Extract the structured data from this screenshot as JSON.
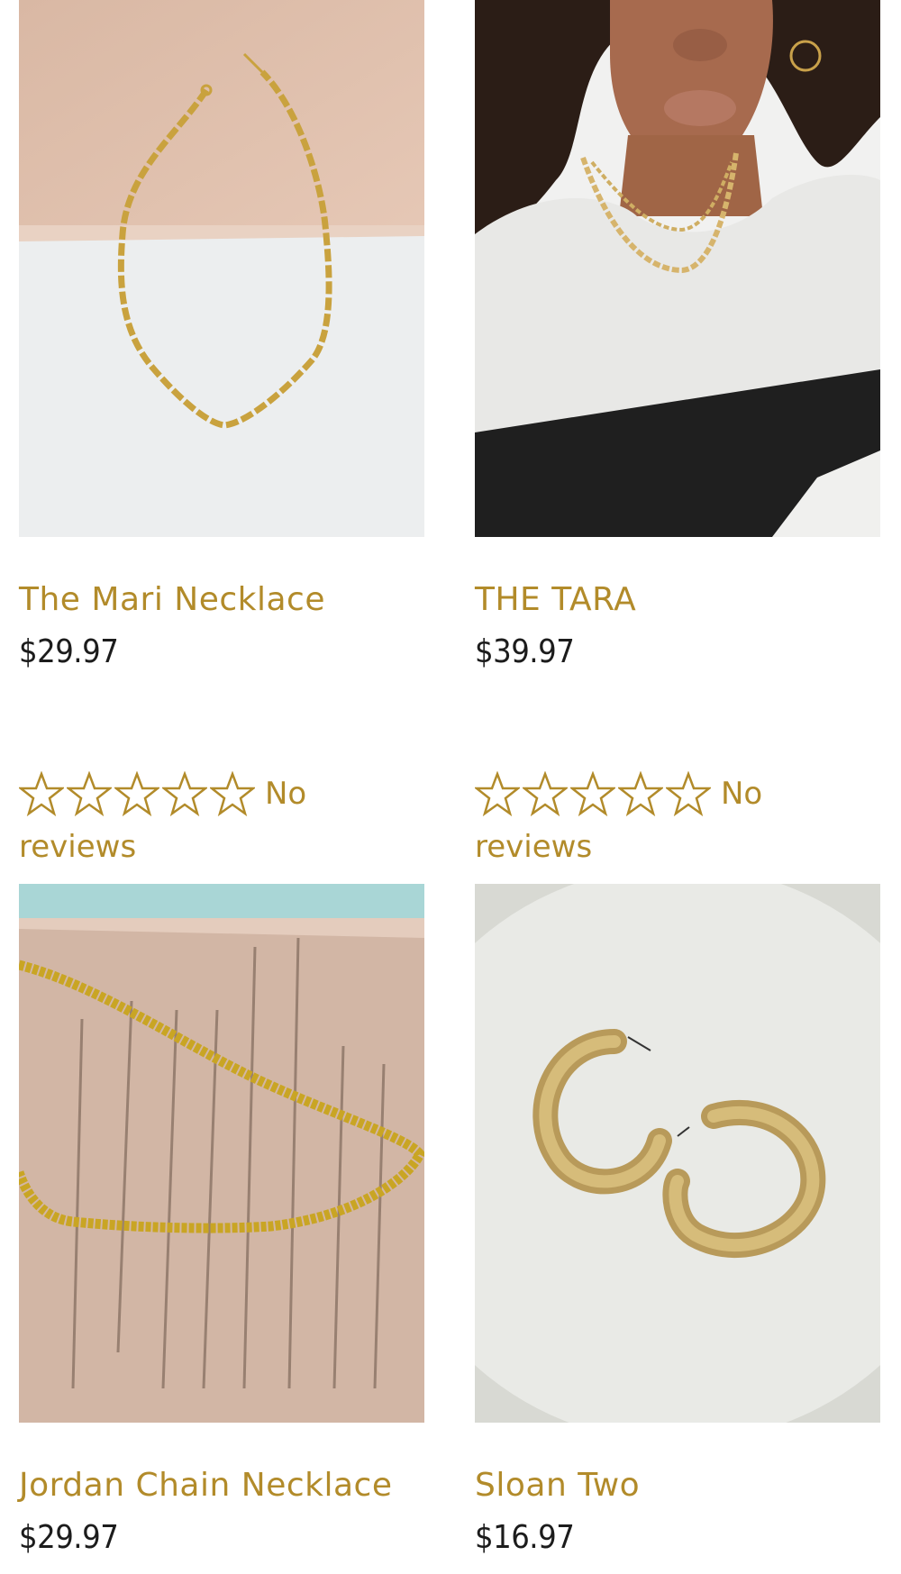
{
  "products": [
    {
      "title": "The Mari Necklace",
      "price": "$29.97",
      "image_label": "gold paperclip chain necklace"
    },
    {
      "title": "THE TARA",
      "price": "$39.97",
      "image_label": "model wearing layered gold chain necklaces"
    },
    {
      "title": "Jordan Chain Necklace",
      "price": "$29.97",
      "image_label": "gold curb chain necklace on book page"
    },
    {
      "title": "Sloan Two",
      "price": "$16.97",
      "image_label": "gold hoop earrings on marble"
    }
  ],
  "ratings": [
    {
      "stars_filled": 0,
      "stars_total": 5,
      "label_no": "No",
      "label_reviews": "reviews"
    },
    {
      "stars_filled": 0,
      "stars_total": 5,
      "label_no": "No",
      "label_reviews": "reviews"
    }
  ],
  "colors": {
    "accent": "#b28b2a",
    "price": "#1c1c1c"
  }
}
